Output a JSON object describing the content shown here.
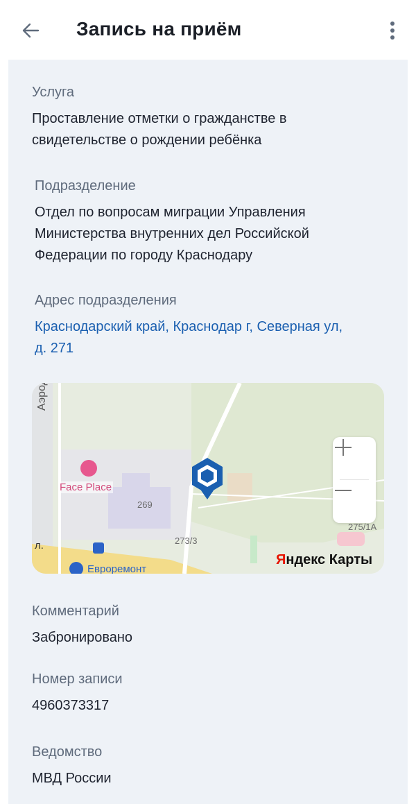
{
  "header": {
    "title": "Запись на приём"
  },
  "service": {
    "label": "Услуга",
    "value_line1": "Проставление отметки о гражданстве в",
    "value_line2": "свидетельстве о рождении ребёнка"
  },
  "department": {
    "label": "Подразделение",
    "value_line1": "Отдел по вопросам миграции Управления",
    "value_line2": "Министерства внутренних дел Российской",
    "value_line3": "Федерации по городу Краснодару"
  },
  "address": {
    "label": "Адрес подразделения",
    "value_line1": "Краснодарский край, Краснодар г, Северная ул,",
    "value_line2": "д. 271"
  },
  "map": {
    "street_label": "Аэродромная у",
    "poi_name": "Face Place",
    "building_269": "269",
    "building_273": "273/3",
    "building_275": "275/1А",
    "street_fragment": "л.",
    "store_name": "Евроремонт",
    "brand_first": "Я",
    "brand_rest": "ндекс Карты",
    "pin_color": "#1a5fb0"
  },
  "comment": {
    "label": "Комментарий",
    "value": "Забронировано"
  },
  "record": {
    "label": "Номер записи",
    "value": "4960373317"
  },
  "agency": {
    "label": "Ведомство",
    "value": "МВД России"
  },
  "colors": {
    "card_bg": "#eef2f7",
    "link": "#1a5fb0",
    "label": "#5f6b7c"
  }
}
